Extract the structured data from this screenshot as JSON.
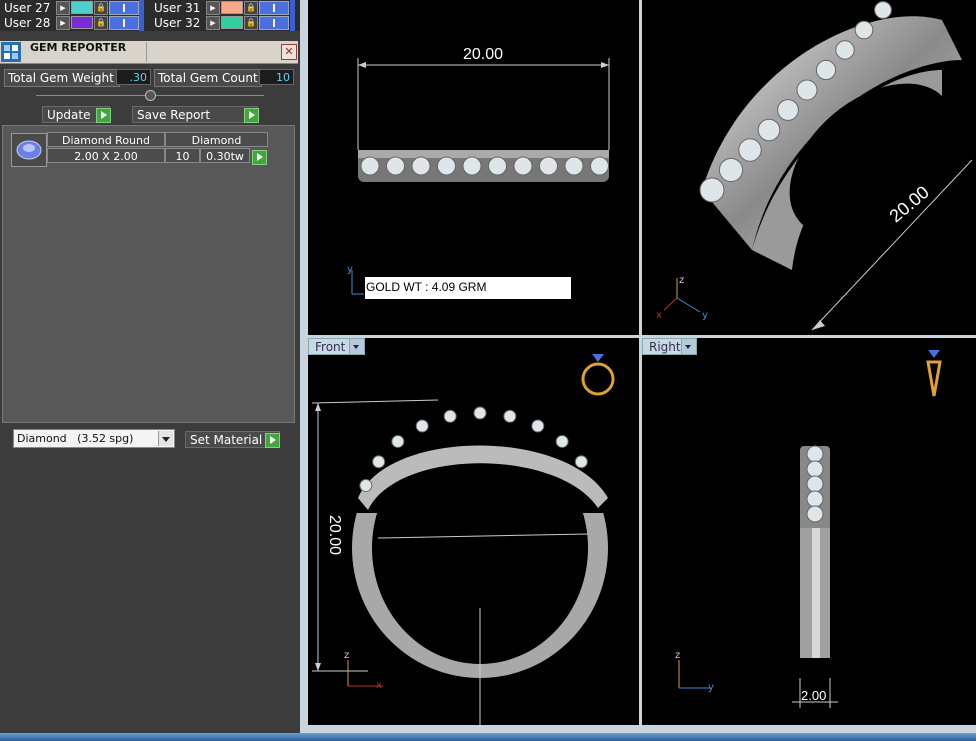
{
  "layers": [
    {
      "name": "User 27",
      "color": "#4fd0cf"
    },
    {
      "name": "User 28",
      "color": "#7a2bd8"
    },
    {
      "name": "User 31",
      "color": "#f7a98a"
    },
    {
      "name": "User 32",
      "color": "#2fcfa0"
    }
  ],
  "gem_reporter": {
    "title": "GEM REPORTER",
    "total_weight_label": "Total Gem Weight",
    "total_weight_value": ".30",
    "total_count_label": "Total Gem Count",
    "total_count_value": "10",
    "update_label": "Update",
    "save_report_label": "Save Report",
    "gem": {
      "shape": "Diamond Round",
      "size": "2.00 X 2.00",
      "material": "Diamond",
      "count": "10",
      "weight": "0.30tw"
    },
    "material_select": "Diamond   (3.52 spg)",
    "set_material_label": "Set Material"
  },
  "viewports": {
    "top": {
      "dimension": "20.00",
      "annotation": "GOLD WT : 4.09 GRM"
    },
    "perspective": {
      "dimension": "20.00"
    },
    "front": {
      "tab": "Front",
      "dimension": "20.00"
    },
    "right": {
      "tab": "Right",
      "dimension": "2.00"
    }
  },
  "colors": {
    "accent": "#3fa83a",
    "value_text": "#5fd0ff",
    "viewport_bg": "#000000"
  }
}
